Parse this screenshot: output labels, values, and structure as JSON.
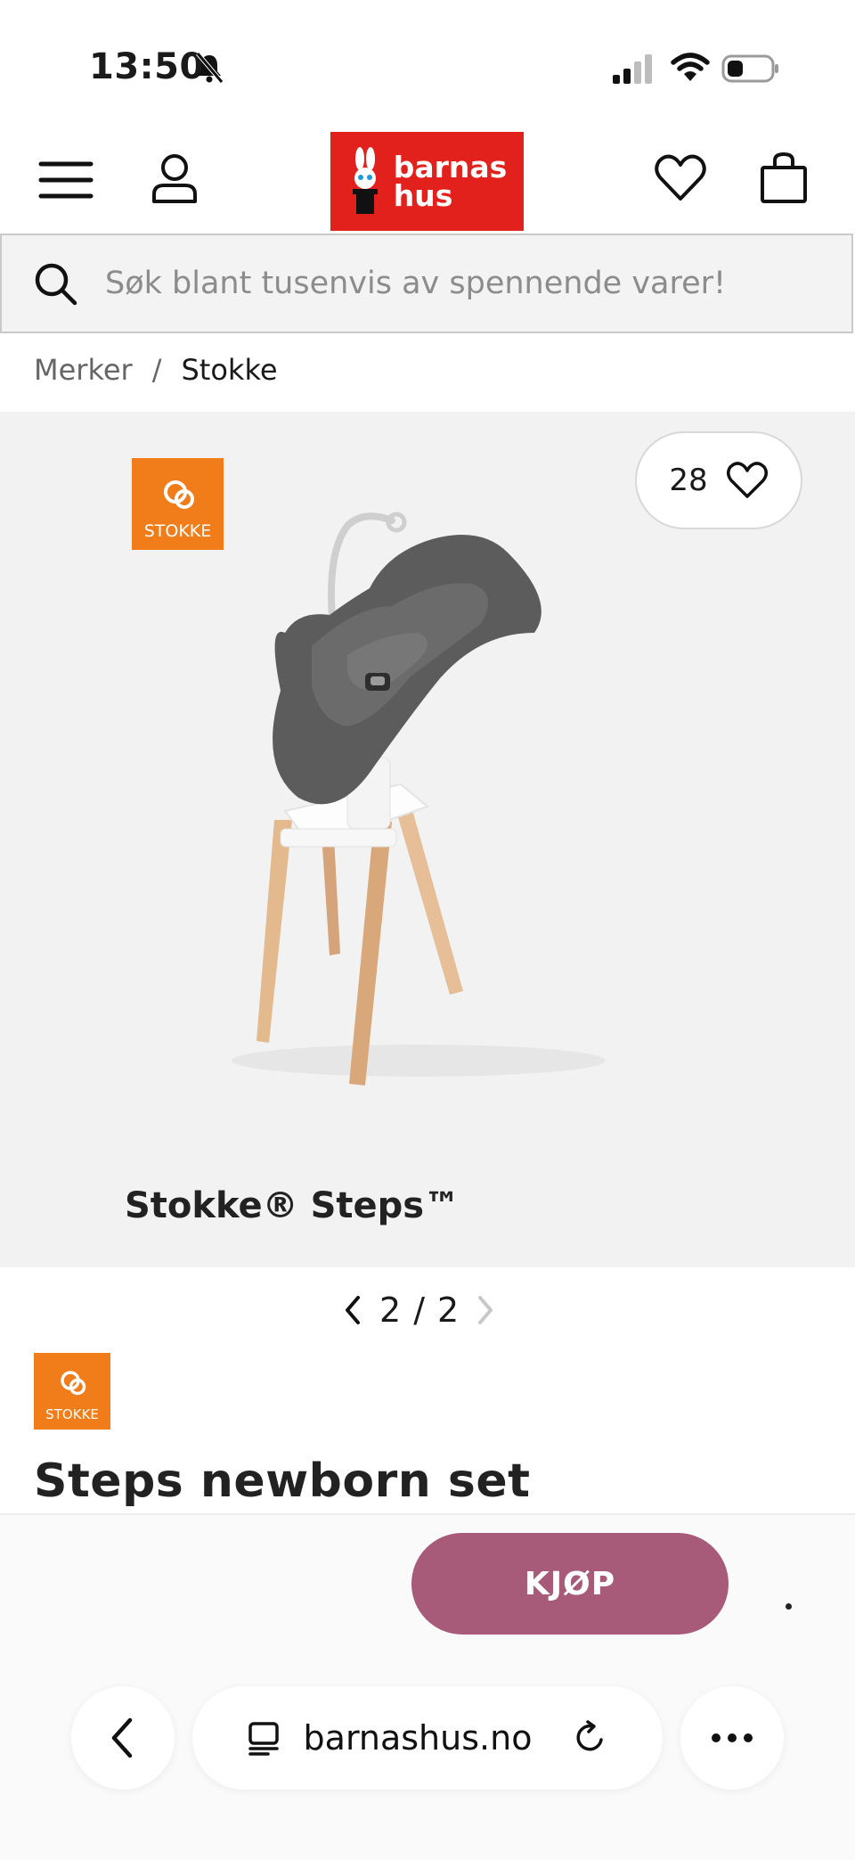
{
  "status_bar": {
    "time": "13:50"
  },
  "header": {
    "logo_line1": "barnas",
    "logo_line2": "hus"
  },
  "search": {
    "placeholder": "Søk blant tusenvis av spennende varer!"
  },
  "breadcrumb": {
    "items": [
      "Merker",
      "/",
      "Stokke"
    ]
  },
  "gallery": {
    "favorite_count": "28",
    "brand_badge_text": "STOKKE",
    "image_caption": "Stokke® Steps™",
    "pager_current": "2",
    "pager_separator": "/",
    "pager_total": "2"
  },
  "product": {
    "brand_badge_text": "STOKKE",
    "title": "Steps newborn set"
  },
  "actions": {
    "buy_label": "KJØP"
  },
  "browser": {
    "url": "barnashus.no"
  },
  "colors": {
    "logo_red": "#e3211c",
    "buy_button": "#a85b78",
    "stokke_orange": "#f07d1a"
  }
}
